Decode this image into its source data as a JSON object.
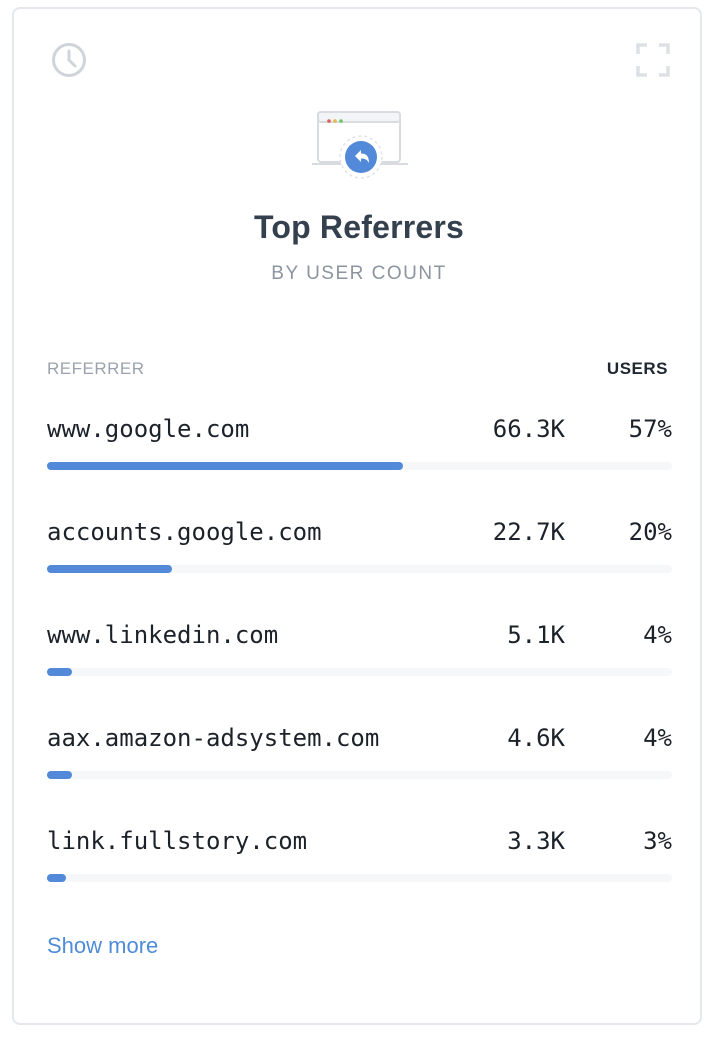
{
  "widget": {
    "title": "Top Referrers",
    "subtitle": "BY USER COUNT",
    "icons": {
      "history": "clock-icon",
      "expand": "expand-icon",
      "hero": "browser-reply-icon"
    },
    "columns": {
      "referrer": "REFERRER",
      "users": "USERS"
    },
    "rows": [
      {
        "name": "www.google.com",
        "count": "66.3K",
        "percent": "57%",
        "bar_fraction": 0.57
      },
      {
        "name": "accounts.google.com",
        "count": "22.7K",
        "percent": "20%",
        "bar_fraction": 0.2
      },
      {
        "name": "www.linkedin.com",
        "count": "5.1K",
        "percent": "4%",
        "bar_fraction": 0.04
      },
      {
        "name": "aax.amazon-adsystem.com",
        "count": "4.6K",
        "percent": "4%",
        "bar_fraction": 0.04
      },
      {
        "name": "link.fullstory.com",
        "count": "3.3K",
        "percent": "3%",
        "bar_fraction": 0.03
      }
    ],
    "show_more_label": "Show more",
    "colors": {
      "accent": "#5289d9",
      "link": "#4f8cd8",
      "title": "#34404e",
      "muted": "#8c959f",
      "track": "#f6f7f8",
      "border": "#e4e7eb"
    }
  }
}
